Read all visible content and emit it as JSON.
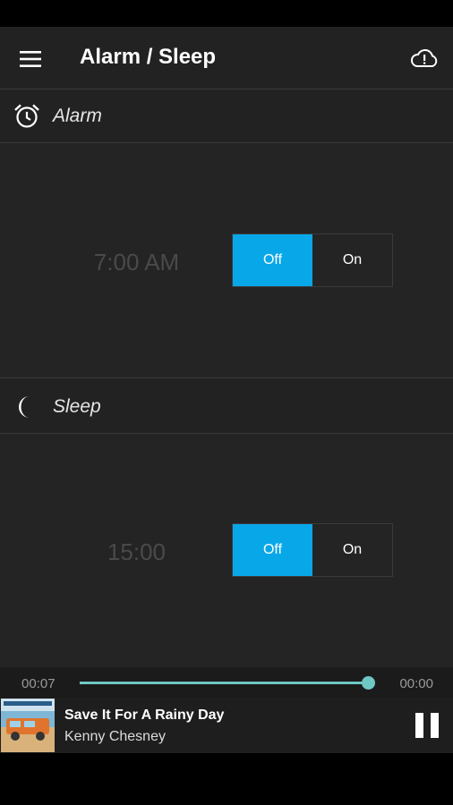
{
  "app": {
    "title": "Alarm / Sleep"
  },
  "icons": {
    "menu": "hamburger-menu-icon",
    "cloud": "cloud-alert-icon",
    "alarm": "alarm-clock-icon",
    "sleep": "moon-icon",
    "pause": "pause-icon"
  },
  "alarm": {
    "label": "Alarm",
    "time": "7:00 AM",
    "off_label": "Off",
    "on_label": "On",
    "state": "Off"
  },
  "sleep": {
    "label": "Sleep",
    "time": "15:00",
    "off_label": "Off",
    "on_label": "On",
    "state": "Off"
  },
  "player": {
    "elapsed": "00:07",
    "remaining": "00:00",
    "progress_fraction": 0.98,
    "song": "Save It For A Rainy Day",
    "artist": "Kenny Chesney"
  },
  "colors": {
    "accent": "#08a7e8",
    "progress": "#6fc7c4",
    "background": "#222222"
  }
}
